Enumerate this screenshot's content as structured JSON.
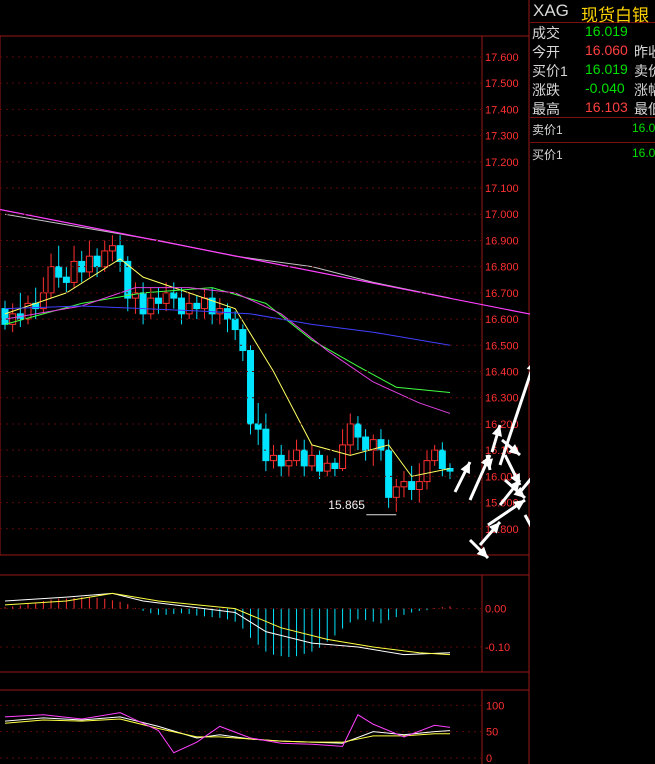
{
  "instrument": {
    "symbol": "XAG",
    "name": "现货白银"
  },
  "quote": [
    {
      "label": "成交",
      "value": "16.019",
      "color": "#00e000",
      "right": ""
    },
    {
      "label": "今开",
      "value": "16.060",
      "color": "#ff4040",
      "right": "昨收"
    },
    {
      "label": "买价1",
      "value": "16.019",
      "color": "#00e000",
      "right": "卖价"
    },
    {
      "label": "涨跌",
      "value": "-0.040",
      "color": "#00e000",
      "right": "涨幅"
    },
    {
      "label": "最高",
      "value": "16.103",
      "color": "#ff4040",
      "right": "最低"
    }
  ],
  "orderbook": [
    {
      "label": "卖价1",
      "value": "16.0"
    },
    {
      "label": "买价1",
      "value": "16.0"
    }
  ],
  "colors": {
    "up": "#ff3030",
    "down": "#00e5ff",
    "frame": "#9a1818",
    "axis_text": "#ff3030"
  },
  "chart_data": [
    {
      "type": "candlestick",
      "panel": "price",
      "y_ticks": [
        "17.600",
        "17.500",
        "17.400",
        "17.300",
        "17.200",
        "17.100",
        "17.000",
        "16.900",
        "16.800",
        "16.700",
        "16.600",
        "16.500",
        "16.400",
        "16.300",
        "16.200",
        "16.100",
        "16.000",
        "15.900",
        "15.800"
      ],
      "ylim": [
        15.7,
        17.68
      ],
      "annotations": [
        {
          "text": "15.865",
          "value": 15.865,
          "bar": 51
        }
      ],
      "candles": [
        [
          16.64,
          16.58,
          16.67,
          16.56
        ],
        [
          16.58,
          16.62,
          16.66,
          16.55
        ],
        [
          16.62,
          16.6,
          16.7,
          16.57
        ],
        [
          16.6,
          16.66,
          16.69,
          16.58
        ],
        [
          16.66,
          16.64,
          16.72,
          16.6
        ],
        [
          16.64,
          16.7,
          16.76,
          16.62
        ],
        [
          16.7,
          16.8,
          16.85,
          16.68
        ],
        [
          16.8,
          16.76,
          16.88,
          16.72
        ],
        [
          16.76,
          16.74,
          16.8,
          16.7
        ],
        [
          16.74,
          16.82,
          16.88,
          16.72
        ],
        [
          16.82,
          16.78,
          16.86,
          16.74
        ],
        [
          16.78,
          16.84,
          16.9,
          16.76
        ],
        [
          16.84,
          16.8,
          16.87,
          16.76
        ],
        [
          16.8,
          16.86,
          16.9,
          16.78
        ],
        [
          16.86,
          16.88,
          16.92,
          16.82
        ],
        [
          16.88,
          16.82,
          16.92,
          16.78
        ],
        [
          16.82,
          16.68,
          16.84,
          16.63
        ],
        [
          16.68,
          16.7,
          16.74,
          16.62
        ],
        [
          16.7,
          16.62,
          16.74,
          16.58
        ],
        [
          16.62,
          16.68,
          16.72,
          16.6
        ],
        [
          16.68,
          16.66,
          16.72,
          16.62
        ],
        [
          16.66,
          16.7,
          16.74,
          16.63
        ],
        [
          16.7,
          16.68,
          16.74,
          16.64
        ],
        [
          16.68,
          16.62,
          16.72,
          16.58
        ],
        [
          16.62,
          16.66,
          16.7,
          16.6
        ],
        [
          16.66,
          16.64,
          16.69,
          16.6
        ],
        [
          16.64,
          16.68,
          16.72,
          16.6
        ],
        [
          16.68,
          16.62,
          16.72,
          16.58
        ],
        [
          16.62,
          16.64,
          16.68,
          16.58
        ],
        [
          16.64,
          16.6,
          16.66,
          16.55
        ],
        [
          16.6,
          16.56,
          16.63,
          16.52
        ],
        [
          16.56,
          16.48,
          16.58,
          16.44
        ],
        [
          16.48,
          16.2,
          16.5,
          16.16
        ],
        [
          16.2,
          16.18,
          16.28,
          16.12
        ],
        [
          16.18,
          16.06,
          16.24,
          16.02
        ],
        [
          16.06,
          16.08,
          16.12,
          16.03
        ],
        [
          16.08,
          16.04,
          16.12,
          16.0
        ],
        [
          16.04,
          16.06,
          16.1,
          16.0
        ],
        [
          16.06,
          16.1,
          16.14,
          16.04
        ],
        [
          16.1,
          16.04,
          16.14,
          16.0
        ],
        [
          16.04,
          16.08,
          16.12,
          16.02
        ],
        [
          16.08,
          16.02,
          16.1,
          15.99
        ],
        [
          16.02,
          16.05,
          16.08,
          16.0
        ],
        [
          16.05,
          16.03,
          16.07,
          16.0
        ],
        [
          16.03,
          16.12,
          16.18,
          16.02
        ],
        [
          16.12,
          16.2,
          16.24,
          16.08
        ],
        [
          16.2,
          16.15,
          16.23,
          16.1
        ],
        [
          16.15,
          16.1,
          16.18,
          16.06
        ],
        [
          16.1,
          16.14,
          16.16,
          16.04
        ],
        [
          16.14,
          16.1,
          16.18,
          16.06
        ],
        [
          16.1,
          15.92,
          16.14,
          15.88
        ],
        [
          15.92,
          15.96,
          15.99,
          15.865
        ],
        [
          15.96,
          15.98,
          16.02,
          15.92
        ],
        [
          15.98,
          15.95,
          16.04,
          15.91
        ],
        [
          15.95,
          15.98,
          16.05,
          15.9
        ],
        [
          15.98,
          16.06,
          16.1,
          15.95
        ],
        [
          16.06,
          16.1,
          16.12,
          16.04
        ],
        [
          16.1,
          16.03,
          16.13,
          16.0
        ],
        [
          16.03,
          16.02,
          16.05,
          15.99
        ]
      ],
      "ma_lines": [
        {
          "color": "#ffff60",
          "points": [
            [
              0,
              16.62
            ],
            [
              8,
              16.7
            ],
            [
              15,
              16.83
            ],
            [
              18,
              16.76
            ],
            [
              24,
              16.7
            ],
            [
              30,
              16.64
            ],
            [
              35,
              16.4
            ],
            [
              40,
              16.12
            ],
            [
              45,
              16.08
            ],
            [
              50,
              16.12
            ],
            [
              53,
              16.0
            ],
            [
              58,
              16.03
            ]
          ]
        },
        {
          "color": "#40ff40",
          "points": [
            [
              0,
              16.58
            ],
            [
              10,
              16.66
            ],
            [
              18,
              16.7
            ],
            [
              27,
              16.72
            ],
            [
              34,
              16.66
            ],
            [
              40,
              16.52
            ],
            [
              46,
              16.42
            ],
            [
              51,
              16.34
            ],
            [
              58,
              16.32
            ]
          ]
        },
        {
          "color": "#e040e0",
          "points": [
            [
              0,
              16.6
            ],
            [
              10,
              16.65
            ],
            [
              17,
              16.72
            ],
            [
              24,
              16.72
            ],
            [
              30,
              16.7
            ],
            [
              36,
              16.62
            ],
            [
              42,
              16.48
            ],
            [
              48,
              16.36
            ],
            [
              54,
              16.28
            ],
            [
              58,
              16.24
            ]
          ]
        },
        {
          "color": "#4040ff",
          "points": [
            [
              0,
              16.64
            ],
            [
              10,
              16.65
            ],
            [
              18,
              16.64
            ],
            [
              26,
              16.63
            ],
            [
              32,
              16.62
            ],
            [
              40,
              16.58
            ],
            [
              48,
              16.55
            ],
            [
              58,
              16.5
            ]
          ]
        },
        {
          "color": "#c0c0c0",
          "points": [
            [
              0,
              17.0
            ],
            [
              10,
              16.95
            ],
            [
              20,
              16.9
            ],
            [
              30,
              16.84
            ],
            [
              40,
              16.8
            ],
            [
              48,
              16.74
            ],
            [
              58,
              16.68
            ]
          ]
        }
      ],
      "overlay_line": {
        "color": "#ff40ff",
        "points": [
          [
            -1,
            17.02
          ],
          [
            70,
            16.61
          ]
        ]
      }
    },
    {
      "type": "bar",
      "panel": "macd",
      "y_ticks": [
        "0.00",
        "-0.10"
      ],
      "ylim": [
        -0.16,
        0.08
      ],
      "hist": [
        0.004,
        0.006,
        0.008,
        0.012,
        0.016,
        0.02,
        0.024,
        0.026,
        0.026,
        0.028,
        0.03,
        0.03,
        0.028,
        0.026,
        0.022,
        0.018,
        0.012,
        0.002,
        -0.006,
        -0.012,
        -0.016,
        -0.016,
        -0.014,
        -0.012,
        -0.014,
        -0.018,
        -0.02,
        -0.022,
        -0.024,
        -0.028,
        -0.034,
        -0.052,
        -0.076,
        -0.094,
        -0.112,
        -0.12,
        -0.124,
        -0.126,
        -0.124,
        -0.118,
        -0.112,
        -0.102,
        -0.086,
        -0.07,
        -0.052,
        -0.036,
        -0.028,
        -0.03,
        -0.034,
        -0.038,
        -0.03,
        -0.022,
        -0.016,
        -0.01,
        -0.006,
        -0.004,
        0.002,
        0.004,
        0.006
      ],
      "dif": [
        [
          0,
          0.02
        ],
        [
          8,
          0.03
        ],
        [
          14,
          0.04
        ],
        [
          18,
          0.02
        ],
        [
          26,
          0.0
        ],
        [
          30,
          -0.01
        ],
        [
          34,
          -0.06
        ],
        [
          40,
          -0.09
        ],
        [
          46,
          -0.1
        ],
        [
          52,
          -0.12
        ],
        [
          58,
          -0.115
        ]
      ],
      "dea": [
        [
          0,
          0.01
        ],
        [
          8,
          0.02
        ],
        [
          14,
          0.04
        ],
        [
          20,
          0.02
        ],
        [
          30,
          0.0
        ],
        [
          36,
          -0.05
        ],
        [
          42,
          -0.08
        ],
        [
          48,
          -0.1
        ],
        [
          54,
          -0.115
        ],
        [
          58,
          -0.12
        ]
      ]
    },
    {
      "type": "line",
      "panel": "kdj",
      "y_ticks": [
        "100",
        "50",
        "0"
      ],
      "ylim": [
        0,
        110
      ],
      "series": [
        {
          "color": "#ffffff",
          "points": [
            [
              0,
              70
            ],
            [
              5,
              76
            ],
            [
              10,
              72
            ],
            [
              15,
              78
            ],
            [
              20,
              60
            ],
            [
              25,
              38
            ],
            [
              28,
              44
            ],
            [
              32,
              36
            ],
            [
              36,
              32
            ],
            [
              40,
              30
            ],
            [
              44,
              28
            ],
            [
              48,
              50
            ],
            [
              52,
              44
            ],
            [
              56,
              50
            ],
            [
              58,
              52
            ]
          ]
        },
        {
          "color": "#ffff40",
          "points": [
            [
              0,
              66
            ],
            [
              5,
              72
            ],
            [
              10,
              70
            ],
            [
              15,
              74
            ],
            [
              20,
              56
            ],
            [
              25,
              40
            ],
            [
              28,
              40
            ],
            [
              32,
              36
            ],
            [
              36,
              32
            ],
            [
              40,
              30
            ],
            [
              44,
              30
            ],
            [
              48,
              42
            ],
            [
              52,
              42
            ],
            [
              56,
              46
            ],
            [
              58,
              46
            ]
          ]
        },
        {
          "color": "#ff40ff",
          "points": [
            [
              0,
              78
            ],
            [
              5,
              82
            ],
            [
              10,
              74
            ],
            [
              15,
              86
            ],
            [
              20,
              52
            ],
            [
              22,
              10
            ],
            [
              25,
              30
            ],
            [
              28,
              60
            ],
            [
              32,
              38
            ],
            [
              36,
              28
            ],
            [
              40,
              26
            ],
            [
              44,
              22
            ],
            [
              46,
              82
            ],
            [
              48,
              64
            ],
            [
              52,
              40
            ],
            [
              56,
              62
            ],
            [
              58,
              58
            ]
          ]
        }
      ]
    }
  ]
}
